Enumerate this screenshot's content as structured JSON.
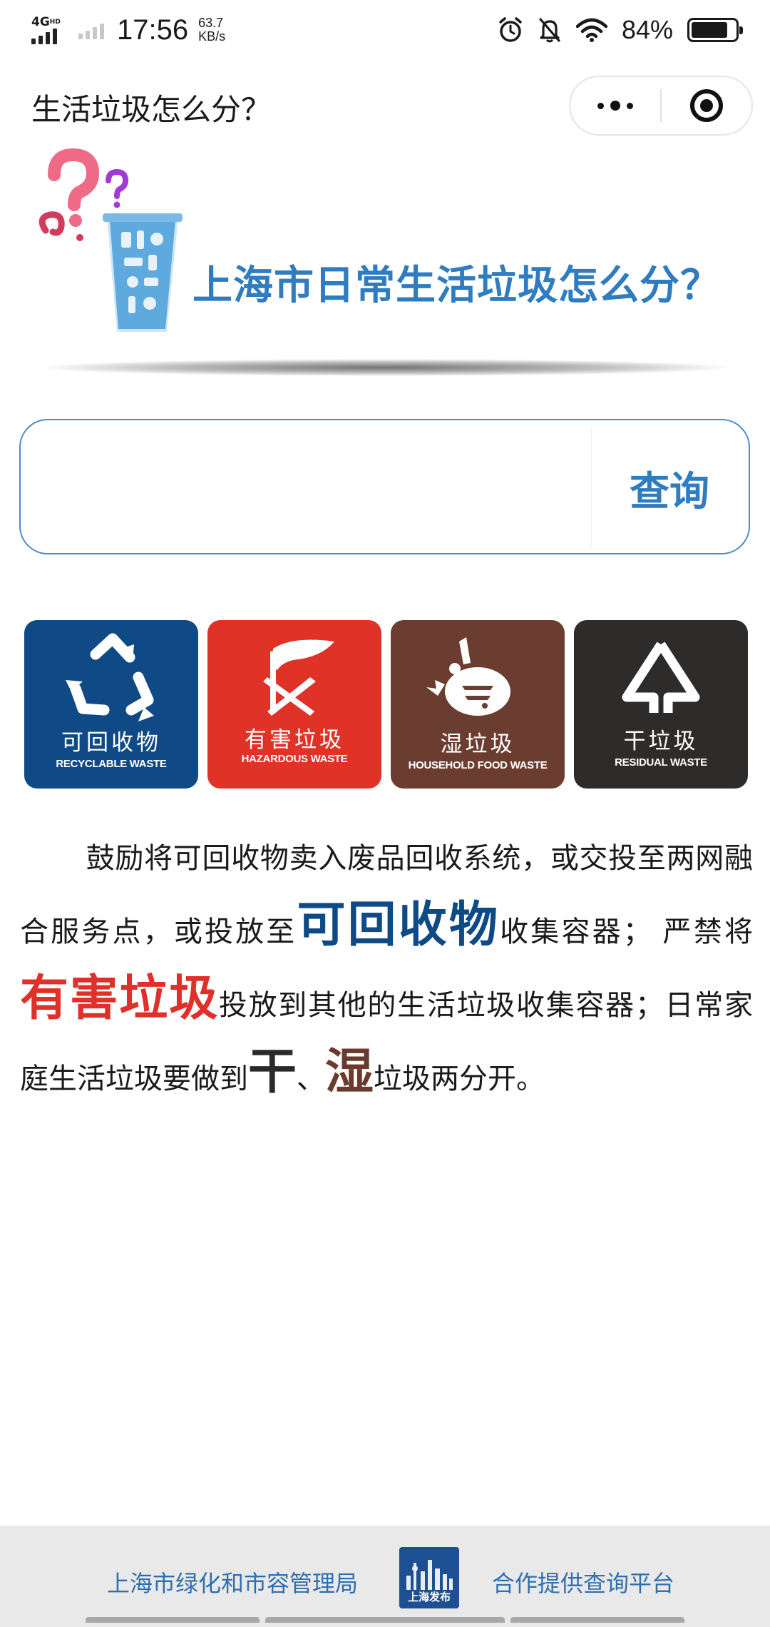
{
  "status_bar": {
    "network": "4G",
    "network_sub": "HD",
    "time": "17:56",
    "speed_value": "63.7",
    "speed_unit": "KB/s",
    "battery_text": "84%",
    "battery_level": 0.84,
    "icons": [
      "alarm-icon",
      "bell-muted-icon",
      "wifi-icon",
      "battery-icon"
    ]
  },
  "header": {
    "title": "生活垃圾怎么分？",
    "more_icon": "more-dots-icon",
    "close_icon": "target-close-icon"
  },
  "banner": {
    "heading": "上海市日常生活垃圾怎么分？",
    "colors": {
      "heading": "#2f7dc0",
      "question_pink": "#ee6a86",
      "question_purple": "#a23ad6",
      "cup": "#4a9fd8"
    }
  },
  "search": {
    "value": "",
    "placeholder": "",
    "button_label": "查询",
    "accent": "#4a8bc9"
  },
  "categories": [
    {
      "cn": "可回收物",
      "en": "RECYCLABLE WASTE",
      "color": "#0f4a87",
      "icon": "recycle-icon"
    },
    {
      "cn": "有害垃圾",
      "en": "HAZARDOUS WASTE",
      "color": "#e03226",
      "icon": "hazardous-icon"
    },
    {
      "cn": "湿垃圾",
      "en": "HOUSEHOLD FOOD WASTE",
      "color": "#6b3d30",
      "icon": "food-waste-icon"
    },
    {
      "cn": "干垃圾",
      "en": "RESIDUAL WASTE",
      "color": "#2e2c2b",
      "icon": "residual-icon"
    }
  ],
  "intro": {
    "part1": "鼓励将可回收物卖入废品回收系统，或交投至两网融合服务点，或投放至",
    "em1": "可回收物",
    "part2": "收集容器； 严禁将",
    "em2": "有害垃圾",
    "part3": "投放到其他的生活垃圾收集容器；日常家庭生活垃圾要做到",
    "em3": "干",
    "part4": "、",
    "em4": "湿",
    "part5": "垃圾两分开。"
  },
  "footer": {
    "left_text": "上海市绿化和市容管理局",
    "logo_text": "上海发布",
    "right_text": "合作提供查询平台"
  }
}
